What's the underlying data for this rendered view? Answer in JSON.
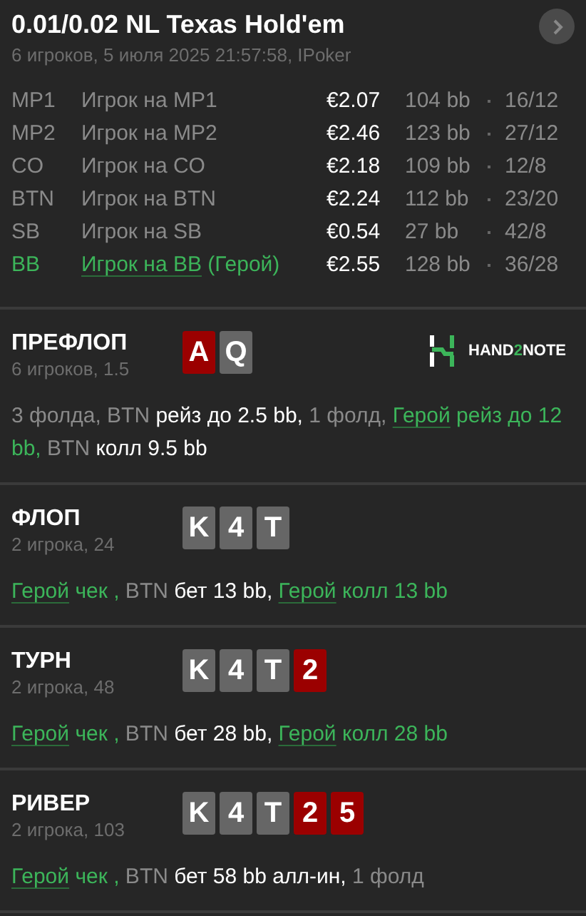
{
  "header": {
    "title": "0.01/0.02 NL Texas Hold'em",
    "subtitle": "6 игроков, 5 июля 2025 21:57:58, IPoker"
  },
  "players": [
    {
      "position": "MP1",
      "name": "Игрок на MP1",
      "stack": "€2.07",
      "bb": "104 bb",
      "stats": "16/12",
      "hero": false
    },
    {
      "position": "MP2",
      "name": "Игрок на MP2",
      "stack": "€2.46",
      "bb": "123 bb",
      "stats": "27/12",
      "hero": false
    },
    {
      "position": "CO",
      "name": "Игрок на CO",
      "stack": "€2.18",
      "bb": "109 bb",
      "stats": "12/8",
      "hero": false
    },
    {
      "position": "BTN",
      "name": "Игрок на BTN",
      "stack": "€2.24",
      "bb": "112 bb",
      "stats": "23/20",
      "hero": false
    },
    {
      "position": "SB",
      "name": "Игрок на SB",
      "stack": "€0.54",
      "bb": "27 bb",
      "stats": "42/8",
      "hero": false
    },
    {
      "position": "BB",
      "name": "Игрок на BB",
      "note": "(Герой)",
      "stack": "€2.55",
      "bb": "128 bb",
      "stats": "36/28",
      "hero": true
    }
  ],
  "logo": {
    "before": "HAND",
    "accent": "2",
    "after": "NOTE"
  },
  "streets": [
    {
      "name": "ПРЕФЛОП",
      "info": "6 игроков, 1.5",
      "logo": true,
      "cards": [
        {
          "rank": "A",
          "color": "#9b0000"
        },
        {
          "rank": "Q",
          "color": "#666666"
        }
      ],
      "actions": [
        {
          "kind": "muted",
          "text": "3 фолда, BTN"
        },
        {
          "kind": "action",
          "text": " рейз до 2.5 bb,"
        },
        {
          "kind": "muted",
          "text": " 1 фолд, "
        },
        {
          "kind": "hero",
          "text": "Герой"
        },
        {
          "kind": "hero-action",
          "text": " рейз до 12 bb,"
        },
        {
          "kind": "muted",
          "text": " BTN"
        },
        {
          "kind": "action",
          "text": " колл 9.5 bb"
        }
      ]
    },
    {
      "name": "ФЛОП",
      "info": "2 игрока, 24",
      "cards": [
        {
          "rank": "K",
          "color": "#666666"
        },
        {
          "rank": "4",
          "color": "#666666"
        },
        {
          "rank": "T",
          "color": "#666666"
        }
      ],
      "actions": [
        {
          "kind": "hero",
          "text": "Герой"
        },
        {
          "kind": "hero-action",
          "text": " чек ,"
        },
        {
          "kind": "muted",
          "text": " BTN"
        },
        {
          "kind": "action",
          "text": " бет 13 bb, "
        },
        {
          "kind": "hero",
          "text": "Герой"
        },
        {
          "kind": "hero-action",
          "text": " колл 13 bb"
        }
      ]
    },
    {
      "name": "ТУРН",
      "info": "2 игрока, 48",
      "cards": [
        {
          "rank": "K",
          "color": "#666666"
        },
        {
          "rank": "4",
          "color": "#666666"
        },
        {
          "rank": "T",
          "color": "#666666"
        },
        {
          "rank": "2",
          "color": "#9b0000"
        }
      ],
      "actions": [
        {
          "kind": "hero",
          "text": "Герой"
        },
        {
          "kind": "hero-action",
          "text": " чек ,"
        },
        {
          "kind": "muted",
          "text": " BTN"
        },
        {
          "kind": "action",
          "text": " бет 28 bb, "
        },
        {
          "kind": "hero",
          "text": "Герой"
        },
        {
          "kind": "hero-action",
          "text": " колл 28 bb"
        }
      ]
    },
    {
      "name": "РИВЕР",
      "info": "2 игрока, 103",
      "cards": [
        {
          "rank": "K",
          "color": "#666666"
        },
        {
          "rank": "4",
          "color": "#666666"
        },
        {
          "rank": "T",
          "color": "#666666"
        },
        {
          "rank": "2",
          "color": "#9b0000"
        },
        {
          "rank": "5",
          "color": "#9b0000"
        }
      ],
      "actions": [
        {
          "kind": "hero",
          "text": "Герой"
        },
        {
          "kind": "hero-action",
          "text": " чек ,"
        },
        {
          "kind": "muted",
          "text": " BTN"
        },
        {
          "kind": "action",
          "text": " бет 58 bb алл-ин,"
        },
        {
          "kind": "muted",
          "text": " 1 фолд"
        }
      ]
    }
  ]
}
